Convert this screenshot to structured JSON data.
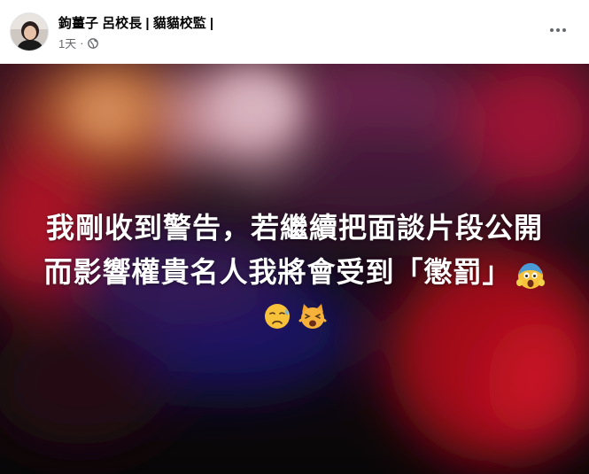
{
  "post": {
    "author": "鉤薑子 呂校長 | 貓貓校監 |",
    "time": "1天",
    "separator": "·",
    "privacy_icon": "globe-icon",
    "more_icon": "more-options-icon"
  },
  "image": {
    "caption_line1": "我剛收到警告，若繼續把面談片段公開",
    "caption_line2": "而影響權貴名人我將會受到「懲罰」",
    "emojis": [
      "face-screaming-in-fear-emoji",
      "sad-relieved-face-emoji",
      "weary-cat-emoji"
    ]
  },
  "colors": {
    "bokeh_red": "#d4142a",
    "bokeh_pink": "#f2b3c3",
    "bokeh_blue": "#1c1c8c",
    "bokeh_orange": "#ff8a3d"
  }
}
